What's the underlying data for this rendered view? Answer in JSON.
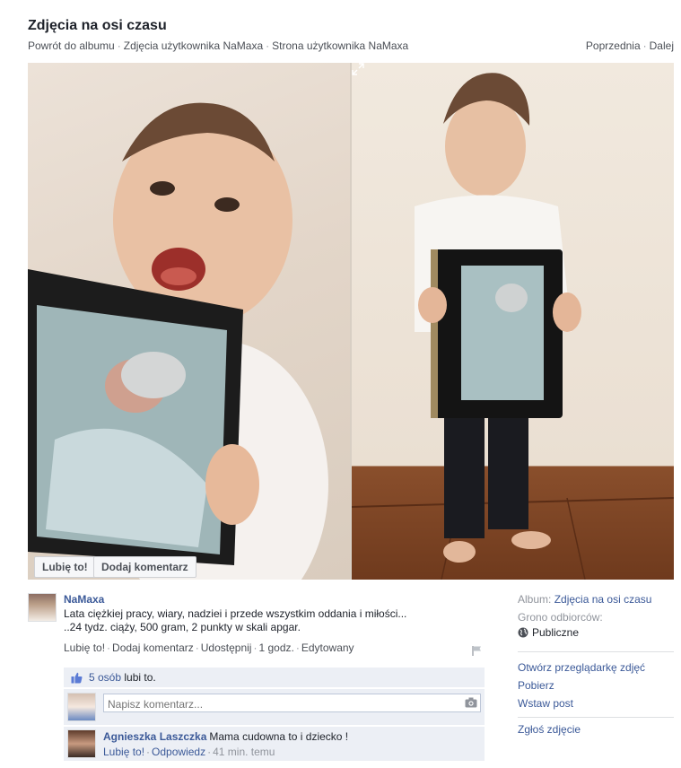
{
  "header": {
    "title": "Zdjęcia na osi czasu",
    "breadcrumb": [
      "Powrót do albumu",
      "Zdjęcia użytkownika NaMaxa",
      "Strona użytkownika NaMaxa"
    ],
    "pager": [
      "Poprzednia",
      "Dalej"
    ]
  },
  "photo": {
    "like_button": "Lubię to!",
    "comment_button": "Dodaj komentarz",
    "expand_icon": "expand-icon"
  },
  "post": {
    "author": "NaMaxa",
    "caption_line1": "Lata ciężkiej pracy, wiary, nadziei i przede wszystkim oddania i miłości...",
    "caption_line2": "..24 tydz. ciąży, 500 gram, 2 punkty w skali apgar.",
    "actions": {
      "like": "Lubię to!",
      "comment": "Dodaj komentarz",
      "share": "Udostępnij",
      "time": "1 godz.",
      "edited": "Edytowany"
    }
  },
  "ufi": {
    "likes_count": "5 osób",
    "likes_suffix": "lubi to.",
    "comment_placeholder": "Napisz komentarz...",
    "comments": [
      {
        "name": "Agnieszka Laszczka",
        "text": "Mama cudowna to i dziecko !",
        "like": "Lubię to!",
        "reply": "Odpowiedz",
        "time": "41 min. temu"
      }
    ]
  },
  "sidebar": {
    "album_label": "Album:",
    "album_value": "Zdjęcia na osi czasu",
    "audience_label": "Grono odbiorców:",
    "audience_value": "Publiczne",
    "links": [
      "Otwórz przeglądarkę zdjęć",
      "Pobierz",
      "Wstaw post"
    ],
    "report": "Zgłoś zdjęcie"
  },
  "colors": {
    "link": "#3b5998",
    "ufi_background": "#eceff5",
    "text": "#1d2129",
    "muted": "#90949c"
  }
}
